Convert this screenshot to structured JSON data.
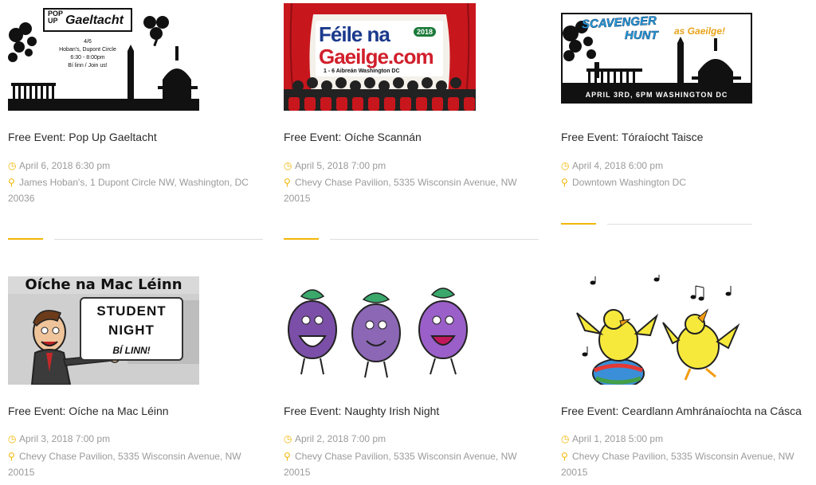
{
  "colors": {
    "accent": "#f2b705",
    "title": "#2b2b2b",
    "meta": "#9a9a9a",
    "rule": "#dddddd"
  },
  "events": [
    {
      "title": "Free Event: Pop Up Gaeltacht",
      "date": "April 6, 2018 6:30 pm",
      "location_line1": "James Hoban's, 1 Dupont Circle NW, Washington, DC",
      "location_line2": "20036",
      "image": {
        "pop": "POP",
        "up": "UP",
        "gaeltacht": "Gaeltacht",
        "info": [
          "4/6",
          "Hoban's, Dupont Circle",
          "6:30 - 8:00pm",
          "Bí linn / Join us!"
        ]
      }
    },
    {
      "title": "Free Event: Oíche Scannán",
      "date": "April 5, 2018 7:00 pm",
      "location_line1": "Chevy Chase Pavilion, 5335 Wisconsin Avenue, NW",
      "location_line2": "20015",
      "image": {
        "line1": "Féile na",
        "line2": "Gaeilge.com",
        "year": "2018",
        "sub": "1 - 6 Aibreán      Washington DC"
      }
    },
    {
      "title": "Free Event: Tóraíocht Taisce",
      "date": "April 4, 2018 6:00 pm",
      "location_line1": "Downtown Washington DC",
      "location_line2": "",
      "image": {
        "scavenger": "SCAVENGER",
        "hunt": "HUNT",
        "as_gaeilge": "as Gaeilge!",
        "date": "APRIL 3RD, 6PM WASHINGTON DC"
      }
    },
    {
      "title": "Free Event: Oíche na Mac Léinn",
      "date": "April 3, 2018 7:00 pm",
      "location_line1": "Chevy Chase Pavilion, 5335 Wisconsin Avenue, NW",
      "location_line2": "20015",
      "image": {
        "heading": "Oíche na Mac Léinn",
        "student": "STUDENT",
        "night": "NIGHT",
        "bi_linn": "BÍ LINN!"
      }
    },
    {
      "title": "Free Event: Naughty Irish Night",
      "date": "April 2, 2018 7:00 pm",
      "location_line1": "Chevy Chase Pavilion, 5335 Wisconsin Avenue, NW",
      "location_line2": "20015"
    },
    {
      "title": "Free Event: Ceardlann Amhránaíochta na Cásca",
      "date": "April 1, 2018 5:00 pm",
      "location_line1": "Chevy Chase Pavilion, 5335 Wisconsin Avenue, NW",
      "location_line2": "20015"
    }
  ],
  "icons": {
    "date": "clock-icon",
    "location": "map-pin-icon"
  }
}
